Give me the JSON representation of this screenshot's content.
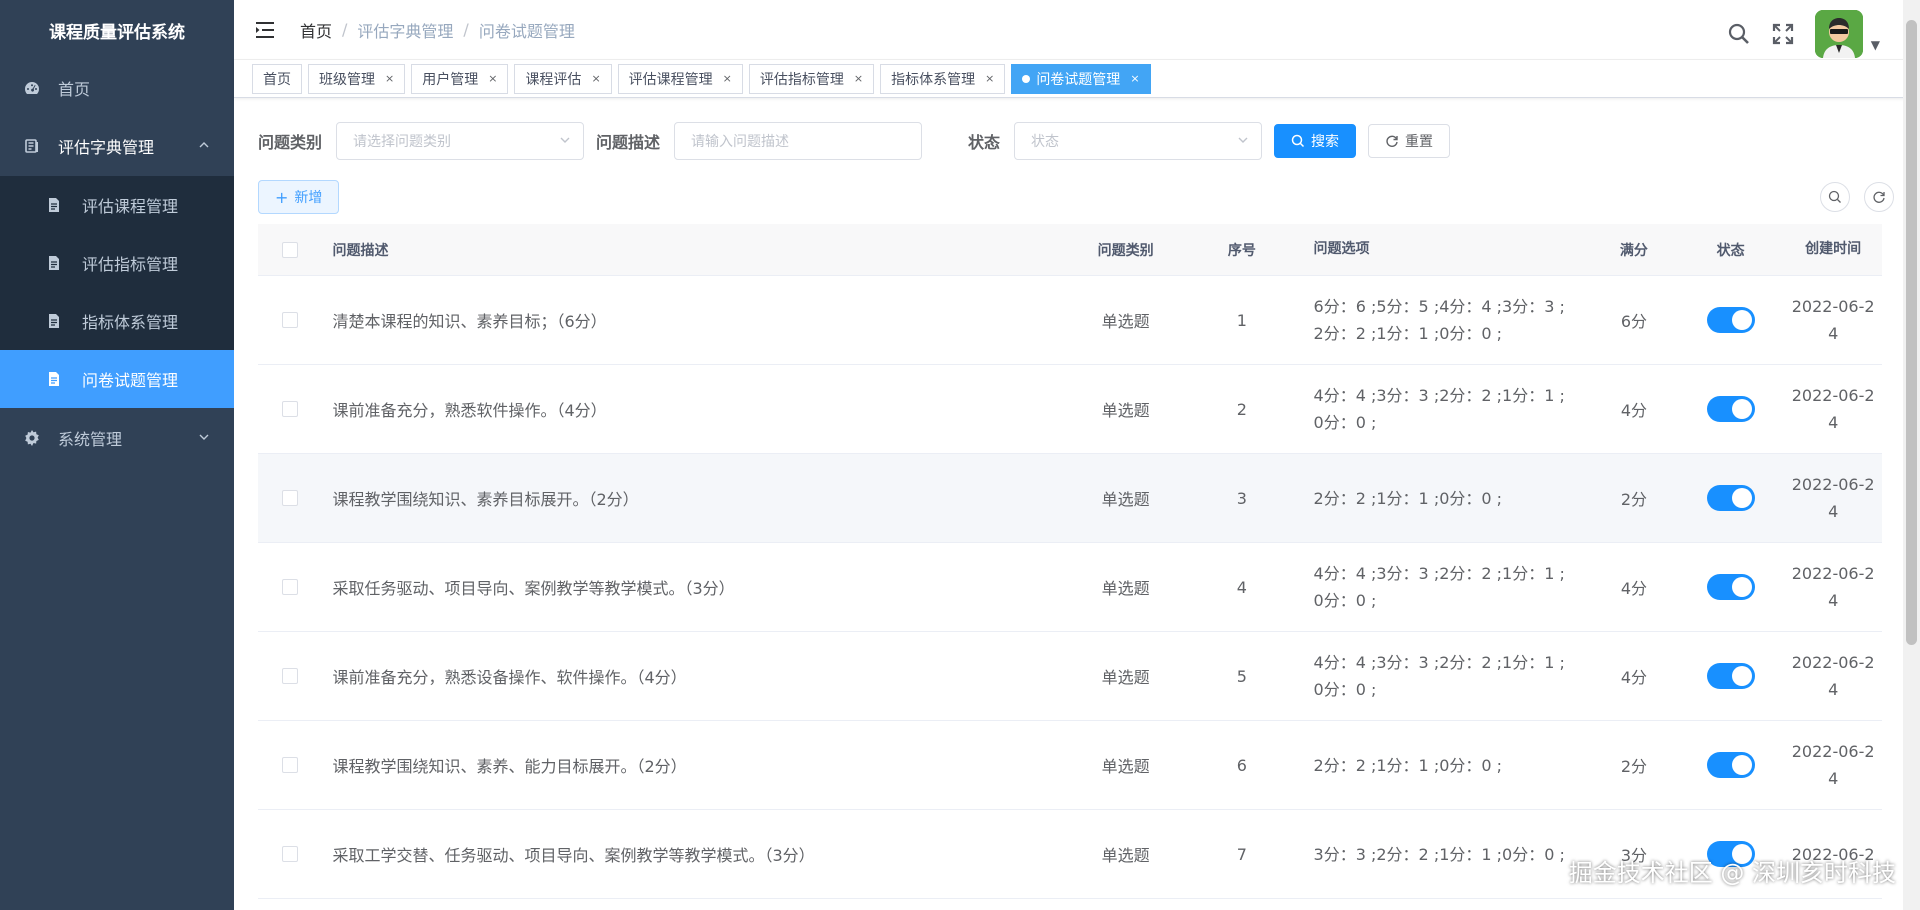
{
  "app": {
    "title": "课程质量评估系统"
  },
  "sidebar": {
    "items": [
      {
        "label": "首页",
        "icon": "dashboard-icon"
      },
      {
        "label": "评估字典管理",
        "icon": "book-icon",
        "open": true,
        "children": [
          {
            "label": "评估课程管理",
            "icon": "document-icon"
          },
          {
            "label": "评估指标管理",
            "icon": "document-icon"
          },
          {
            "label": "指标体系管理",
            "icon": "document-icon"
          },
          {
            "label": "问卷试题管理",
            "icon": "document-icon",
            "active": true
          }
        ]
      },
      {
        "label": "系统管理",
        "icon": "gear-icon"
      }
    ]
  },
  "breadcrumb": [
    "首页",
    "评估字典管理",
    "问卷试题管理"
  ],
  "tabs": [
    {
      "label": "首页",
      "closable": false
    },
    {
      "label": "班级管理",
      "closable": true
    },
    {
      "label": "用户管理",
      "closable": true
    },
    {
      "label": "课程评估",
      "closable": true
    },
    {
      "label": "评估课程管理",
      "closable": true
    },
    {
      "label": "评估指标管理",
      "closable": true
    },
    {
      "label": "指标体系管理",
      "closable": true
    },
    {
      "label": "问卷试题管理",
      "closable": true,
      "active": true
    }
  ],
  "tab_close_glyph": "×",
  "filters": {
    "type_label": "问题类别",
    "type_placeholder": "请选择问题类别",
    "desc_label": "问题描述",
    "desc_placeholder": "请输入问题描述",
    "status_label": "状态",
    "status_placeholder": "状态",
    "search_label": "搜索",
    "reset_label": "重置"
  },
  "toolbar": {
    "add_label": "新增"
  },
  "table": {
    "columns": {
      "desc": "问题描述",
      "type": "问题类别",
      "no": "序号",
      "options": "问题选项",
      "max": "满分",
      "status": "状态",
      "time": "创建时间"
    },
    "rows": [
      {
        "desc": "清楚本课程的知识、素养目标；（6分）",
        "type": "单选题",
        "no": "1",
        "opt1": "6分：6 ;5分：5 ;4分：4 ;3分：3 ;",
        "opt2": "2分：2 ;1分：1 ;0分：0 ;",
        "max": "6分",
        "status_on": true,
        "time1": "2022-06-2",
        "time2": "4"
      },
      {
        "desc": "课前准备充分，熟悉软件操作。（4分）",
        "type": "单选题",
        "no": "2",
        "opt1": "4分：4 ;3分：3 ;2分：2 ;1分：1 ;",
        "opt2": "0分：0 ;",
        "max": "4分",
        "status_on": true,
        "time1": "2022-06-2",
        "time2": "4"
      },
      {
        "desc": "课程教学围绕知识、素养目标展开。（2分）",
        "type": "单选题",
        "no": "3",
        "opt1": "2分：2 ;1分：1 ;0分：0 ;",
        "opt2": "",
        "max": "2分",
        "status_on": true,
        "time1": "2022-06-2",
        "time2": "4"
      },
      {
        "desc": "采取任务驱动、项目导向、案例教学等教学模式。（3分）",
        "type": "单选题",
        "no": "4",
        "opt1": "4分：4 ;3分：3 ;2分：2 ;1分：1 ;",
        "opt2": "0分：0 ;",
        "max": "4分",
        "status_on": true,
        "time1": "2022-06-2",
        "time2": "4"
      },
      {
        "desc": "课前准备充分，熟悉设备操作、软件操作。（4分）",
        "type": "单选题",
        "no": "5",
        "opt1": "4分：4 ;3分：3 ;2分：2 ;1分：1 ;",
        "opt2": "0分：0 ;",
        "max": "4分",
        "status_on": true,
        "time1": "2022-06-2",
        "time2": "4"
      },
      {
        "desc": "课程教学围绕知识、素养、能力目标展开。（2分）",
        "type": "单选题",
        "no": "6",
        "opt1": "2分：2 ;1分：1 ;0分：0 ;",
        "opt2": "",
        "max": "2分",
        "status_on": true,
        "time1": "2022-06-2",
        "time2": "4"
      },
      {
        "desc": "采取工学交替、任务驱动、项目导向、案例教学等教学模式。（3分）",
        "type": "单选题",
        "no": "7",
        "opt1": "3分：3 ;2分：2 ;1分：1 ;0分：0 ;",
        "opt2": "",
        "max": "3分",
        "status_on": true,
        "time1": "2022-06-2",
        "time2": ""
      }
    ]
  },
  "watermark": "掘金技术社区 @ 深圳亥时科技",
  "colors": {
    "sidebar_bg": "#304156",
    "submenu_bg": "#1f2d3d",
    "accent": "#409eff",
    "switch_on": "#1890ff"
  }
}
